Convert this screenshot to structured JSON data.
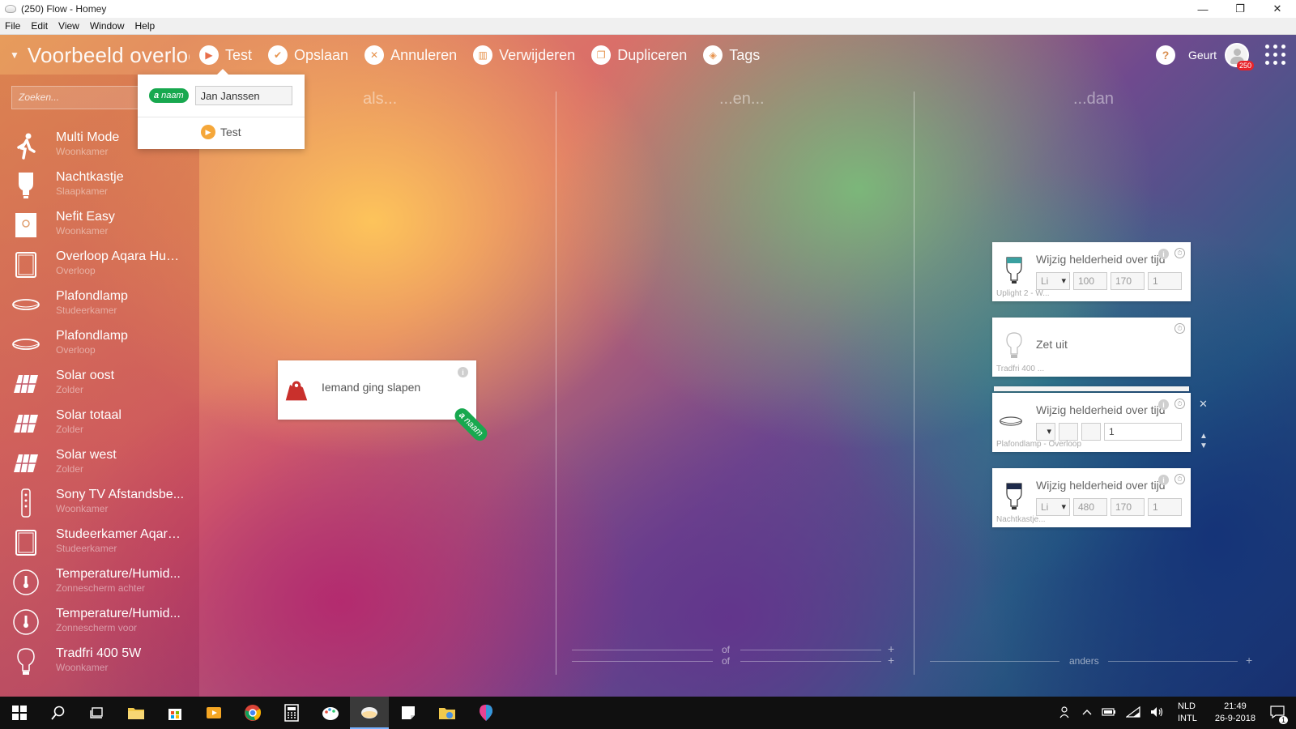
{
  "window": {
    "title": "(250) Flow - Homey",
    "controls": [
      "—",
      "❐",
      "✕"
    ]
  },
  "menu": [
    "File",
    "Edit",
    "View",
    "Window",
    "Help"
  ],
  "toolbar": {
    "flow_title": "Voorbeeld overloop",
    "actions": [
      {
        "label": "Test",
        "icon": "play-icon"
      },
      {
        "label": "Opslaan",
        "icon": "check-icon"
      },
      {
        "label": "Annuleren",
        "icon": "cancel-icon"
      },
      {
        "label": "Verwijderen",
        "icon": "trash-icon"
      },
      {
        "label": "Dupliceren",
        "icon": "duplicate-icon"
      },
      {
        "label": "Tags",
        "icon": "tag-icon"
      }
    ],
    "help": "?",
    "user_name": "Geurt",
    "notification_count": "250"
  },
  "sidebar": {
    "search_placeholder": "Zoeken...",
    "devices": [
      {
        "name": "Multi Mode",
        "zone": "Woonkamer",
        "icon": "walking-person-icon"
      },
      {
        "name": "Nachtkastje",
        "zone": "Slaapkamer",
        "icon": "bulb-icon"
      },
      {
        "name": "Nefit Easy",
        "zone": "Woonkamer",
        "icon": "thermostat-icon"
      },
      {
        "name": "Overloop Aqara Hum...",
        "zone": "Overloop",
        "icon": "sensor-icon"
      },
      {
        "name": "Plafondlamp",
        "zone": "Studeerkamer",
        "icon": "ceiling-lamp-icon"
      },
      {
        "name": "Plafondlamp",
        "zone": "Overloop",
        "icon": "ceiling-lamp-icon"
      },
      {
        "name": "Solar oost",
        "zone": "Zolder",
        "icon": "solar-panel-icon"
      },
      {
        "name": "Solar totaal",
        "zone": "Zolder",
        "icon": "solar-panel-icon"
      },
      {
        "name": "Solar west",
        "zone": "Zolder",
        "icon": "solar-panel-icon"
      },
      {
        "name": "Sony TV Afstandsbe...",
        "zone": "Woonkamer",
        "icon": "remote-icon"
      },
      {
        "name": "Studeerkamer Aqara...",
        "zone": "Studeerkamer",
        "icon": "sensor-icon"
      },
      {
        "name": "Temperature/Humid...",
        "zone": "Zonnescherm achter",
        "icon": "thermometer-icon"
      },
      {
        "name": "Temperature/Humid...",
        "zone": "Zonnescherm voor",
        "icon": "thermometer-icon"
      },
      {
        "name": "Tradfri 400 5W",
        "zone": "Woonkamer",
        "icon": "bulb-icon"
      }
    ]
  },
  "popup": {
    "token_label": "naam",
    "token_prefix": "a",
    "input_value": "Jan Janssen",
    "test_label": "Test"
  },
  "columns": {
    "when": "als...",
    "and": "...en...",
    "then": "...dan",
    "or1": "of",
    "or2": "of",
    "else": "anders",
    "plus": "+"
  },
  "trigger_card": {
    "title": "Iemand ging slapen",
    "token_label": "naam",
    "token_prefix": "a",
    "info": "i"
  },
  "action_cards": [
    {
      "title": "Wijzig helderheid over tijd",
      "device": "Uplight 2 - W...",
      "fields": [
        "Li",
        "100",
        "170",
        "1"
      ]
    },
    {
      "title": "Zet uit",
      "device": "Tradfri 400 ...",
      "fields": []
    },
    {
      "title": "Wijzig helderheid over tijd",
      "device": "Plafondlamp - Overloop",
      "fields": [
        "",
        "",
        "",
        "1"
      ]
    },
    {
      "title": "Wijzig helderheid over tijd",
      "device": "Nachtkastje...",
      "fields": [
        "Li",
        "480",
        "170",
        "1"
      ]
    }
  ],
  "card_controls": {
    "close": "✕",
    "up": "▲",
    "down": "▼",
    "info": "i",
    "timer": "⏱"
  },
  "taskbar": {
    "lang1": "NLD",
    "lang2": "INTL",
    "time": "21:49",
    "date": "26-9-2018",
    "notif_count": "1"
  }
}
